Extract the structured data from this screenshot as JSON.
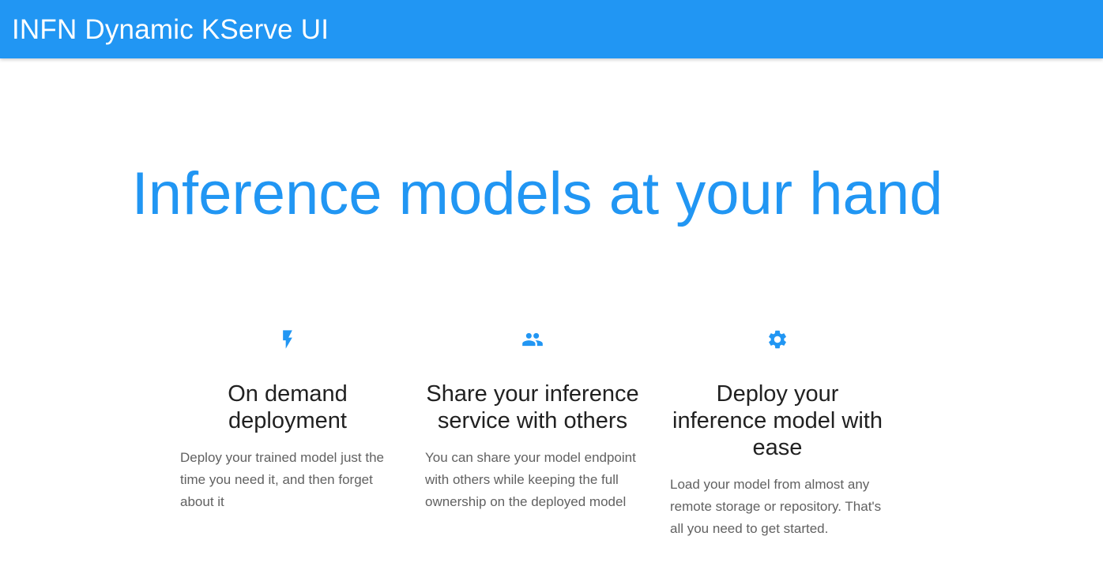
{
  "app": {
    "title": "INFN Dynamic KServe UI"
  },
  "hero": {
    "headline": "Inference models at your hand"
  },
  "features": [
    {
      "icon": "lightning-bolt-icon",
      "title": "On demand deployment",
      "text": "Deploy your trained model just the time you need it, and then forget about it"
    },
    {
      "icon": "people-group-icon",
      "title": "Share your inference service with others",
      "text": "You can share your model endpoint with others while keeping the full ownership on the deployed model"
    },
    {
      "icon": "gear-icon",
      "title": "Deploy your inference model with ease",
      "text": "Load your model from almost any remote storage or repository. That's all you need to get started."
    }
  ],
  "colors": {
    "primary": "#2196f3",
    "title_text": "#212121",
    "body_text": "#616161",
    "background": "#ffffff"
  }
}
